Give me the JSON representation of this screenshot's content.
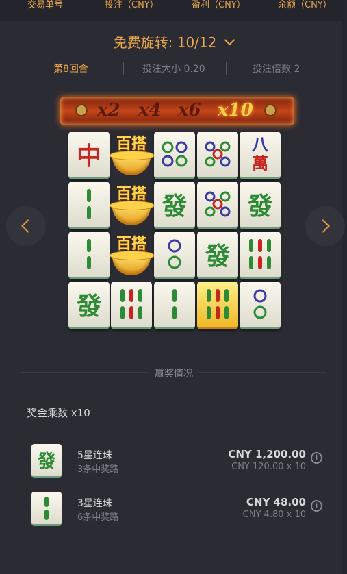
{
  "header": {
    "col1": "交易单号",
    "col2": "投注（CNY）",
    "col3": "盈利（CNY）",
    "col4": "余额（CNY）"
  },
  "free_spins": {
    "label": "免费旋转: 10/12"
  },
  "round_info": {
    "round": "第8回合",
    "bet_size": "投注大小 0.20",
    "bet_multiplier": "投注倍数 2"
  },
  "multiplier_bar": [
    "x2",
    "x4",
    "x6",
    "x10"
  ],
  "multiplier_active": "x10",
  "wild_text": "百搭",
  "tiles": {
    "zhong": "中",
    "fa": "發",
    "ba": "八",
    "wan": "萬"
  },
  "wins": {
    "section_label": "赢奖情况",
    "multiplier_line": "奖金乘数 x10",
    "items": [
      {
        "name": "5星连珠",
        "ways": "3条中奖路",
        "amount": "CNY 1,200.00",
        "calc": "CNY 120.00 x 10"
      },
      {
        "name": "3星连珠",
        "ways": "6条中奖路",
        "amount": "CNY 48.00",
        "calc": "CNY 4.80 x 10"
      }
    ]
  },
  "colors": {
    "accent": "#f0a94a",
    "background": "#2b2b34",
    "tile_green": "#2d8a35"
  }
}
